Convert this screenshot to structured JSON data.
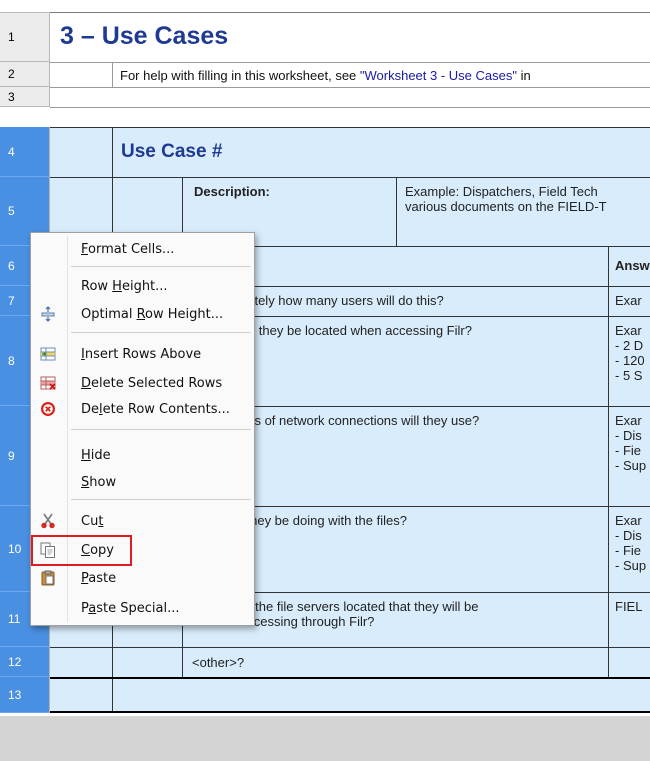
{
  "sheet": {
    "row_numbers": [
      "1",
      "2",
      "3",
      "4",
      "5",
      "6",
      "7",
      "8",
      "9",
      "10",
      "11",
      "12",
      "13"
    ],
    "title": "3 – Use Cases",
    "help_text_prefix": "For help with filling in this worksheet, see ",
    "help_link": "\"Worksheet 3 - Use Cases\"",
    "help_text_suffix": " in",
    "use_case_heading": "Use Case #",
    "description_label": "Description:",
    "description_line1": "Example: Dispatchers, Field Tech",
    "description_line2": "various documents on the FIELD-T",
    "question_header": "n",
    "answer_header": "Answ",
    "q7": "nately how many users will do this?",
    "a7": "Exar",
    "q8": "vill they be located when accessing Filr?",
    "a8": [
      "Exar",
      "- 2 D",
      "- 120",
      "- 5 S"
    ],
    "q9": "nds of network connections will they use?",
    "a9": [
      "Exar",
      "- Dis",
      "- Fie",
      "- Sup"
    ],
    "q10": "l they be doing with the files?",
    "a10": [
      "Exar",
      "- Dis",
      "- Fie",
      "- Sup"
    ],
    "q11_line1": "re the file servers located that they will be",
    "q11_line2": "accessing through Filr?",
    "a11": "FIEL",
    "q12": "<other>?"
  },
  "context_menu": {
    "items": [
      {
        "name": "format-cells",
        "pre": "",
        "key": "F",
        "post": "ormat Cells...",
        "icon": ""
      },
      {
        "name": "row-height",
        "pre": "Row ",
        "key": "H",
        "post": "eight...",
        "icon": ""
      },
      {
        "name": "optimal-row-height",
        "pre": "Optimal ",
        "key": "R",
        "post": "ow Height...",
        "icon": "optimal-row-height-icon"
      },
      {
        "name": "insert-rows-above",
        "pre": "",
        "key": "I",
        "post": "nsert Rows Above",
        "icon": "insert-rows-icon"
      },
      {
        "name": "delete-selected-rows",
        "pre": "",
        "key": "D",
        "post": "elete Selected Rows",
        "icon": "delete-rows-icon"
      },
      {
        "name": "delete-row-contents",
        "pre": "De",
        "key": "l",
        "post": "ete Row Contents...",
        "icon": "delete-contents-icon"
      },
      {
        "name": "hide",
        "pre": "",
        "key": "H",
        "post": "ide",
        "icon": ""
      },
      {
        "name": "show",
        "pre": "",
        "key": "S",
        "post": "how",
        "icon": ""
      },
      {
        "name": "cut",
        "pre": "Cu",
        "key": "t",
        "post": "",
        "icon": "scissors-icon"
      },
      {
        "name": "copy",
        "pre": "",
        "key": "C",
        "post": "opy",
        "icon": "copy-icon"
      },
      {
        "name": "paste",
        "pre": "",
        "key": "P",
        "post": "aste",
        "icon": "clipboard-icon"
      },
      {
        "name": "paste-special",
        "pre": "P",
        "key": "a",
        "post": "ste Special...",
        "icon": ""
      }
    ]
  },
  "colors": {
    "title": "#1f3a93",
    "link": "#1a1aa6",
    "band": "#d9ecfb",
    "selected_row": "#4a90e2",
    "highlight": "#e01b24"
  }
}
